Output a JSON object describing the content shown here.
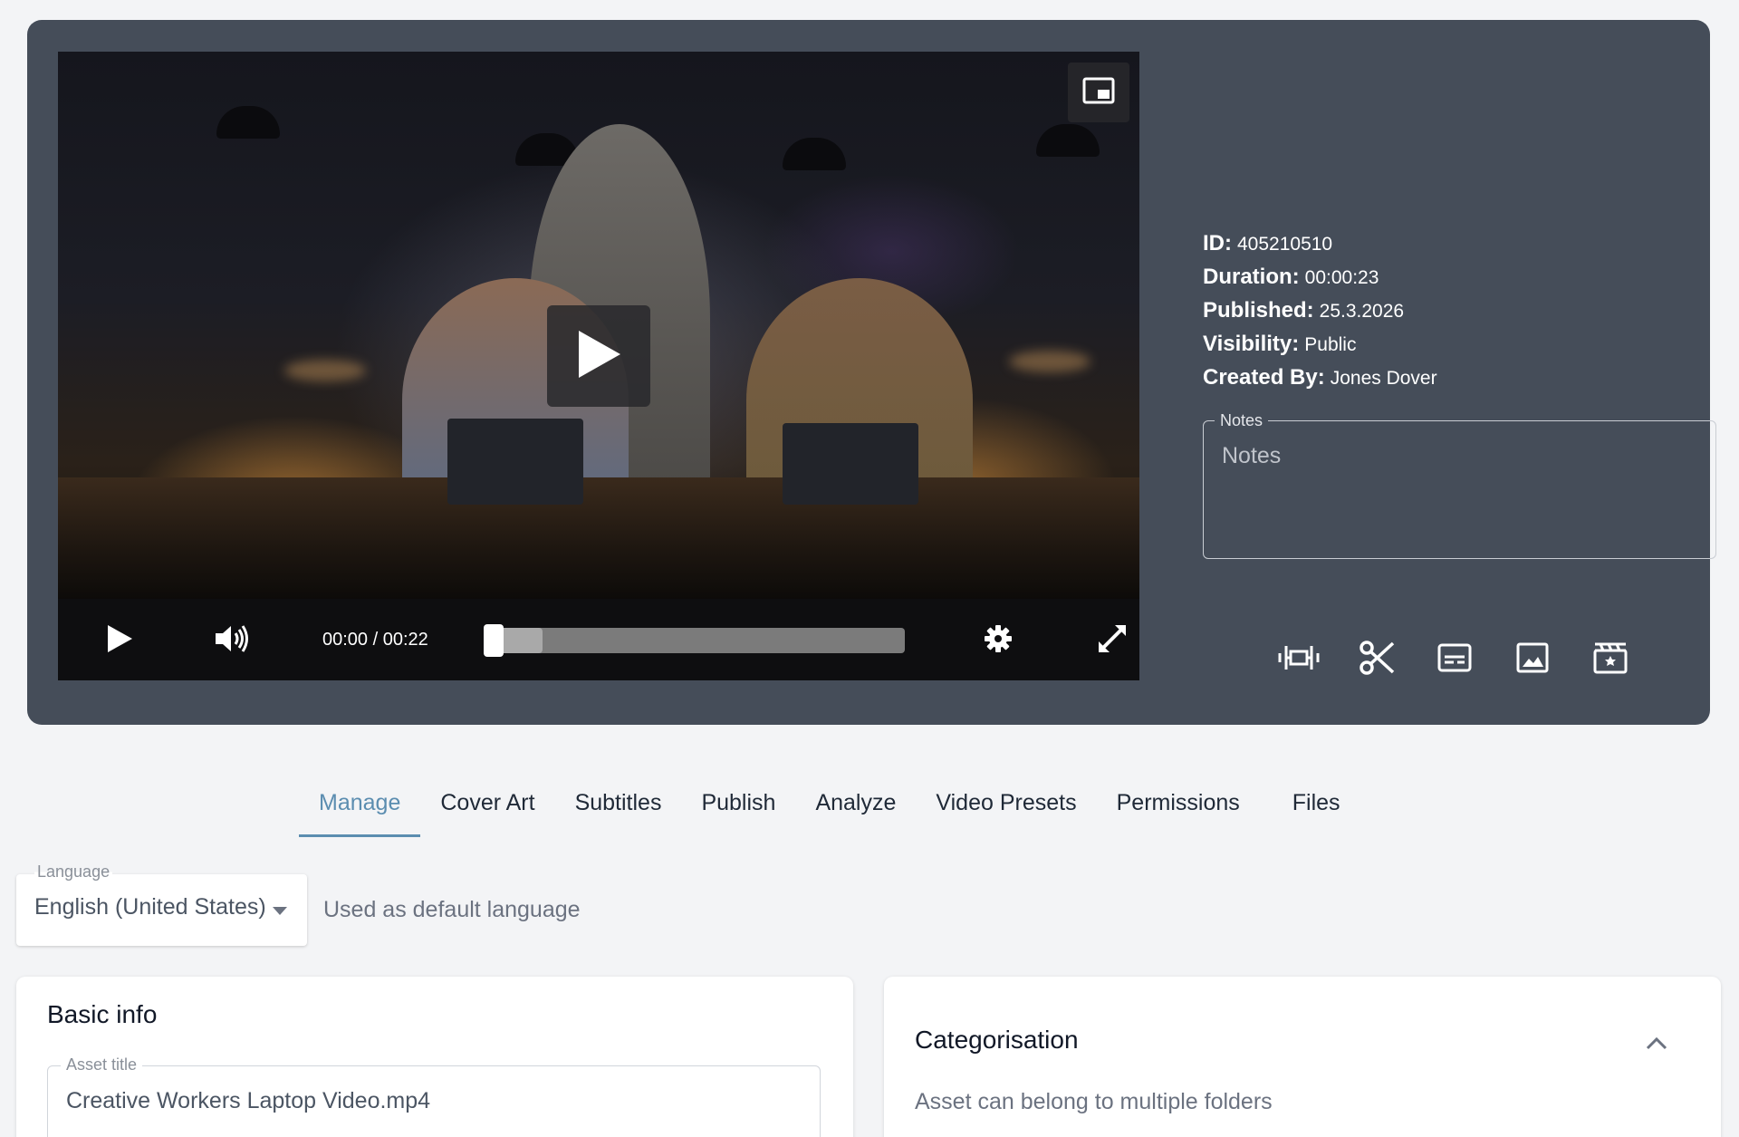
{
  "player": {
    "time_display": "00:00 / 00:22",
    "progress_fraction": 0,
    "buffered_fraction": 0.14,
    "icons": {
      "pip": "picture-in-picture-icon",
      "big_play": "play-icon",
      "play": "play-icon",
      "volume": "volume-icon",
      "settings": "gear-icon",
      "fullscreen": "fullscreen-icon"
    }
  },
  "meta": {
    "id_key": "ID:",
    "id_value": "405210510",
    "duration_key": "Duration:",
    "duration_value": "00:00:23",
    "published_key": "Published:",
    "published_value": "25.3.2026",
    "visibility_key": "Visibility:",
    "visibility_value": "Public",
    "created_key": "Created By:",
    "created_value": "Jones Dover"
  },
  "notes": {
    "legend": "Notes",
    "placeholder": "Notes"
  },
  "tools": [
    "trim-icon",
    "scissors-icon",
    "subtitles-icon",
    "image-icon",
    "clapperboard-icon"
  ],
  "tabs": {
    "manage": "Manage",
    "cover_art": "Cover Art",
    "subtitles": "Subtitles",
    "publish": "Publish",
    "analyze": "Analyze",
    "video_presets": "Video Presets",
    "permissions": "Permissions",
    "files": "Files"
  },
  "language": {
    "label": "Language",
    "value": "English (United States)",
    "hint": "Used as default language"
  },
  "basic_info": {
    "title": "Basic info",
    "asset_title_label": "Asset title",
    "asset_title_value": "Creative Workers Laptop Video.mp4"
  },
  "categorisation": {
    "title": "Categorisation",
    "subtitle": "Asset can belong to multiple folders"
  },
  "colors": {
    "panel": "#454d59",
    "accent": "#5b8db0",
    "background": "#f3f4f6"
  }
}
